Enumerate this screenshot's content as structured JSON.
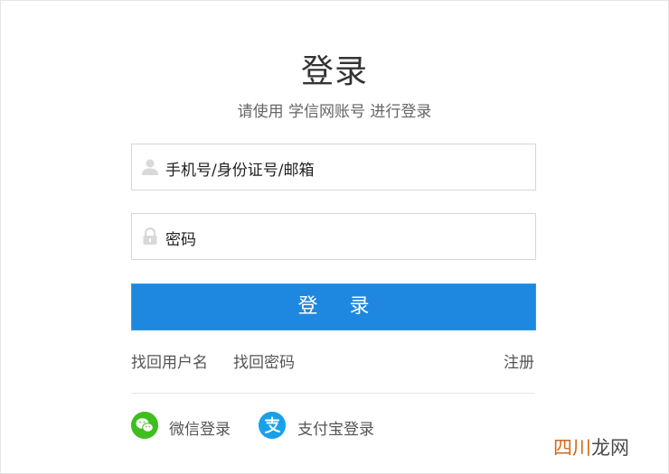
{
  "page": {
    "title": "登录",
    "subtitle": "请使用 学信网账号 进行登录"
  },
  "form": {
    "username_placeholder": "手机号/身份证号/邮箱",
    "password_placeholder": "密码",
    "login_button": "登 录"
  },
  "links": {
    "find_username": "找回用户名",
    "find_password": "找回密码",
    "register": "注册"
  },
  "social": {
    "wechat_label": "微信登录",
    "alipay_label": "支付宝登录",
    "wechat_icon": "wechat-icon",
    "alipay_icon": "alipay-icon"
  },
  "watermark": {
    "accent": "四川",
    "rest": "龙网"
  },
  "colors": {
    "primary_button": "#1e88e0",
    "wechat": "#3fbe1f",
    "alipay": "#1aa0e8"
  }
}
